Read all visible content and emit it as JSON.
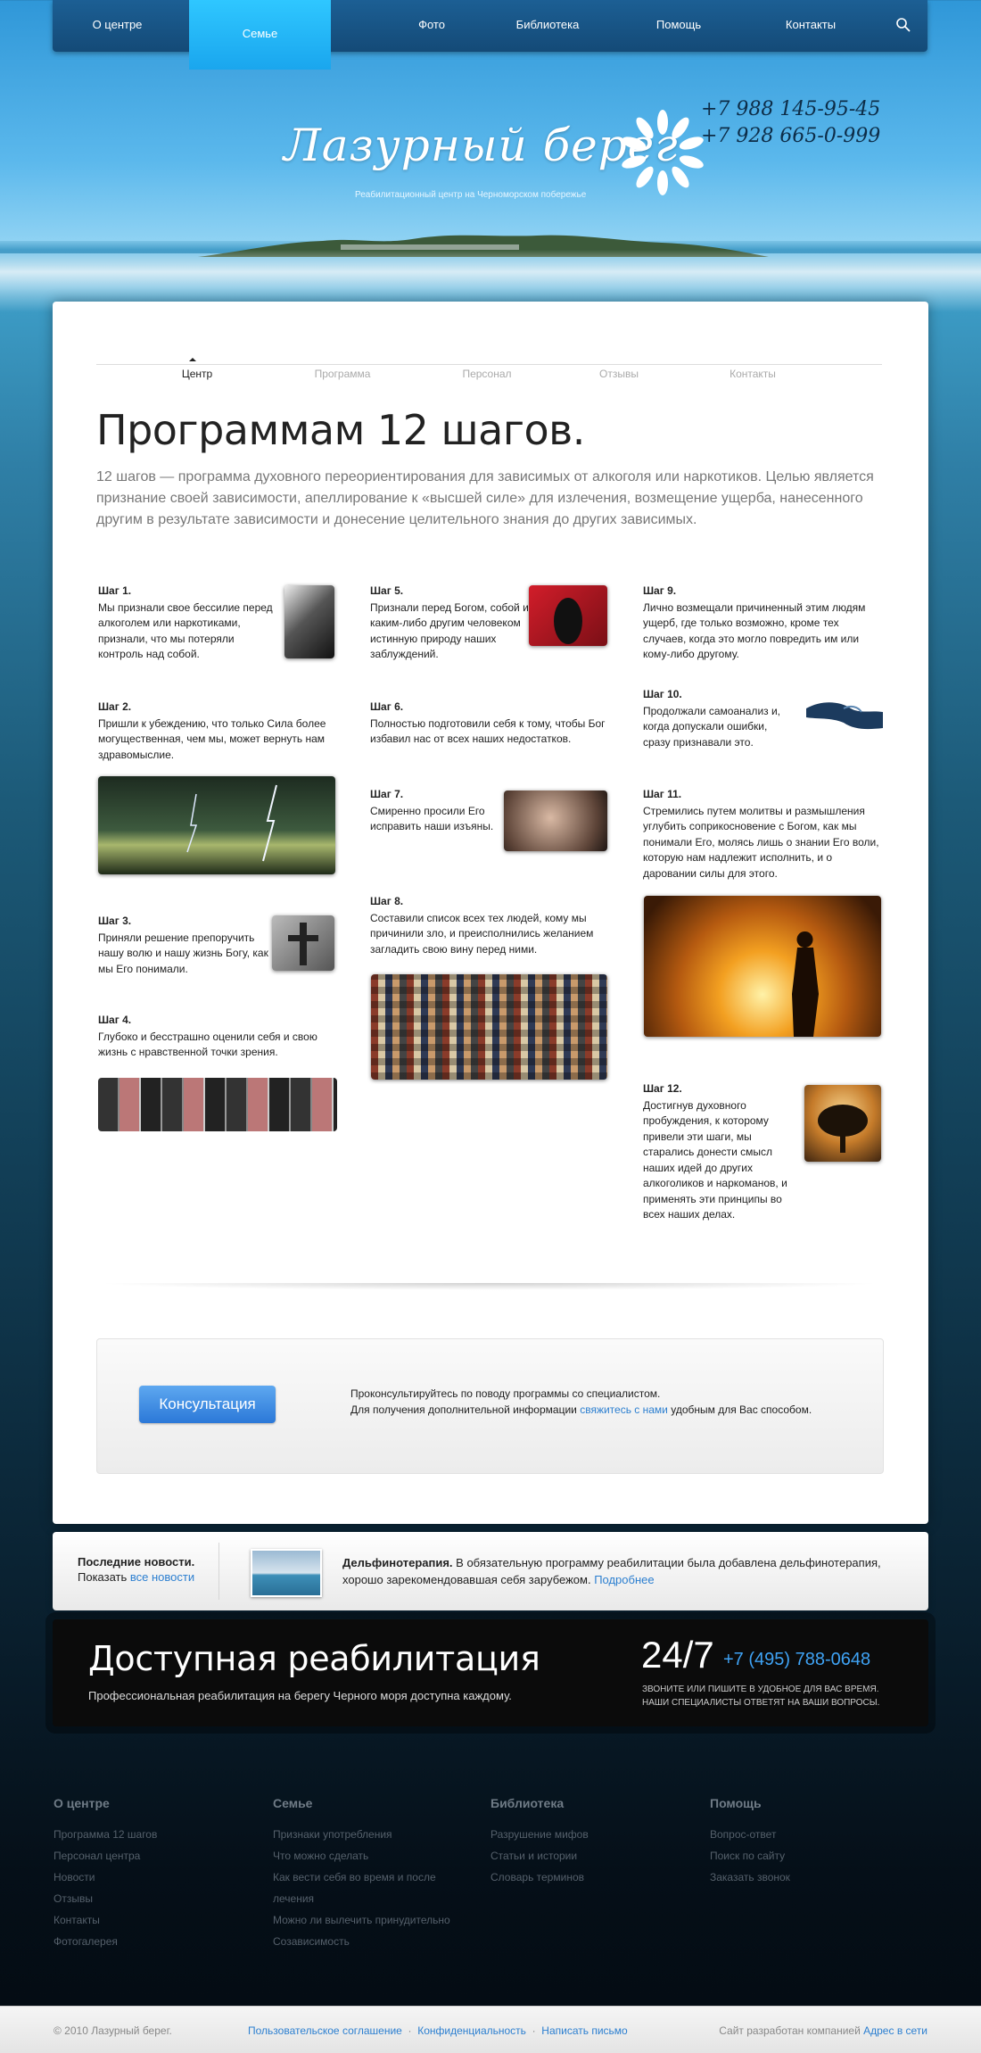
{
  "nav": {
    "items": [
      "О центре",
      "Семье",
      "Фото",
      "Библиотека",
      "Помощь",
      "Контакты"
    ],
    "active": "Семье"
  },
  "logo": {
    "title": "Лазурный берег",
    "subtitle": "Реабилитационный центр на Черноморском побережье"
  },
  "phones": [
    "+7 988 145-95-45",
    "+7 928 665-0-999"
  ],
  "tabs": [
    "Центр",
    "Программа",
    "Персонал",
    "Отзывы",
    "Контакты"
  ],
  "main": {
    "title": "Программам 12 шагов.",
    "intro": "12 шагов — программа духовного переориентирования для зависимых от алкоголя или наркотиков. Целью является признание своей зависимости, апеллирование к «высшей силе» для излечения, возмещение ущерба, нанесенного другим в результате зависимости и донесение целительного знания до других зависимых."
  },
  "steps": {
    "s1": {
      "num": "Шаг 1.",
      "text": "Мы признали свое бессилие перед алкоголем или наркотиками, признали, что мы потеряли контроль над собой."
    },
    "s2": {
      "num": "Шаг 2.",
      "text": "Пришли к убеждению, что только Сила более могущественная, чем мы, может вернуть нам здравомыслие."
    },
    "s3": {
      "num": "Шаг 3.",
      "text": "Приняли решение препоручить нашу волю и нашу жизнь Богу, как мы Его понимали."
    },
    "s4": {
      "num": "Шаг 4.",
      "text": "Глубоко и бесстрашно оценили себя и свою жизнь с нравственной точки зрения."
    },
    "s5": {
      "num": "Шаг 5.",
      "text": "Признали перед Богом, собой и каким-либо другим человеком истинную природу наших заблуждений."
    },
    "s6": {
      "num": "Шаг 6.",
      "text": "Полностью подготовили себя к тому, чтобы Бог избавил нас от всех наших недостатков."
    },
    "s7": {
      "num": "Шаг 7.",
      "text": "Смиренно просили Его исправить наши изъяны."
    },
    "s8": {
      "num": "Шаг 8.",
      "text": "Составили список всех тех людей, кому мы причинили зло, и преисполнились желанием загладить свою вину перед ними."
    },
    "s9": {
      "num": "Шаг 9.",
      "text": "Лично возмещали причиненный этим людям ущерб, где только возможно, кроме тех случаев, когда это могло повредить им или кому-либо другому."
    },
    "s10": {
      "num": "Шаг 10.",
      "text": "Продолжали самоанализ и, когда допускали ошибки, сразу признавали это."
    },
    "s11": {
      "num": "Шаг 11.",
      "text": "Стремились путем молитвы и размышления углубить соприкосновение с Богом, как мы понимали Его, молясь лишь о знании Его воли, которую нам надлежит исполнить, и о даровании силы для этого."
    },
    "s12": {
      "num": "Шаг 12.",
      "text": "Достигнув духовного пробуждения, к которому привели эти шаги, мы старались донести смысл наших идей до других алкоголиков и наркоманов, и применять эти принципы во всех наших делах."
    }
  },
  "consult": {
    "button": "Консультация",
    "line1": "Проконсультируйтесь по поводу программы со специалистом.",
    "line2_before": "Для получения дополнительной информации ",
    "line2_link": "свяжитесь с нами",
    "line2_after": " удобным для Вас способом."
  },
  "news": {
    "heading": "Последние новости.",
    "show": "Показать ",
    "all_link": "все новости",
    "item_title": "Дельфинотерапия.",
    "item_text": " В обязательную программу реабилитации была добавлена дельфинотерапия, хорошо зарекомендовавшая себя зарубежом. ",
    "more": "Подробнее"
  },
  "banner": {
    "title": "Доступная реабилитация",
    "subtitle": "Профессиональная реабилитация на берегу Черного моря доступна каждому.",
    "hours": "24/7",
    "phone": "+7 (495) 788-0648",
    "note1": "Звоните или пишите в удобное для вас время.",
    "note2": "Наши специалисты ответят на ваши вопросы."
  },
  "footer": {
    "cols": [
      {
        "title": "О центре",
        "items": [
          "Программа 12 шагов",
          "Персонал центра",
          "Новости",
          "Отзывы",
          "Контакты",
          "Фотогалерея"
        ]
      },
      {
        "title": "Семье",
        "items": [
          "Признаки употребления",
          "Что можно сделать",
          "Как вести себя во время и после",
          "лечения",
          "Можно ли вылечить принудительно",
          "Созависимость"
        ]
      },
      {
        "title": "Библиотека",
        "items": [
          "Разрушение мифов",
          "Статьи и истории",
          "Словарь терминов"
        ]
      },
      {
        "title": "Помощь",
        "items": [
          "Вопрос-ответ",
          "Поиск по сайту",
          "Заказать звонок"
        ]
      }
    ],
    "copyright": "© 2010 Лазурный берег.",
    "links": [
      "Пользовательское соглашение",
      "Конфиденциальность",
      "Написать письмо"
    ],
    "dev_text": "Сайт разработан компанией ",
    "dev_link": "Адрес в сети"
  }
}
